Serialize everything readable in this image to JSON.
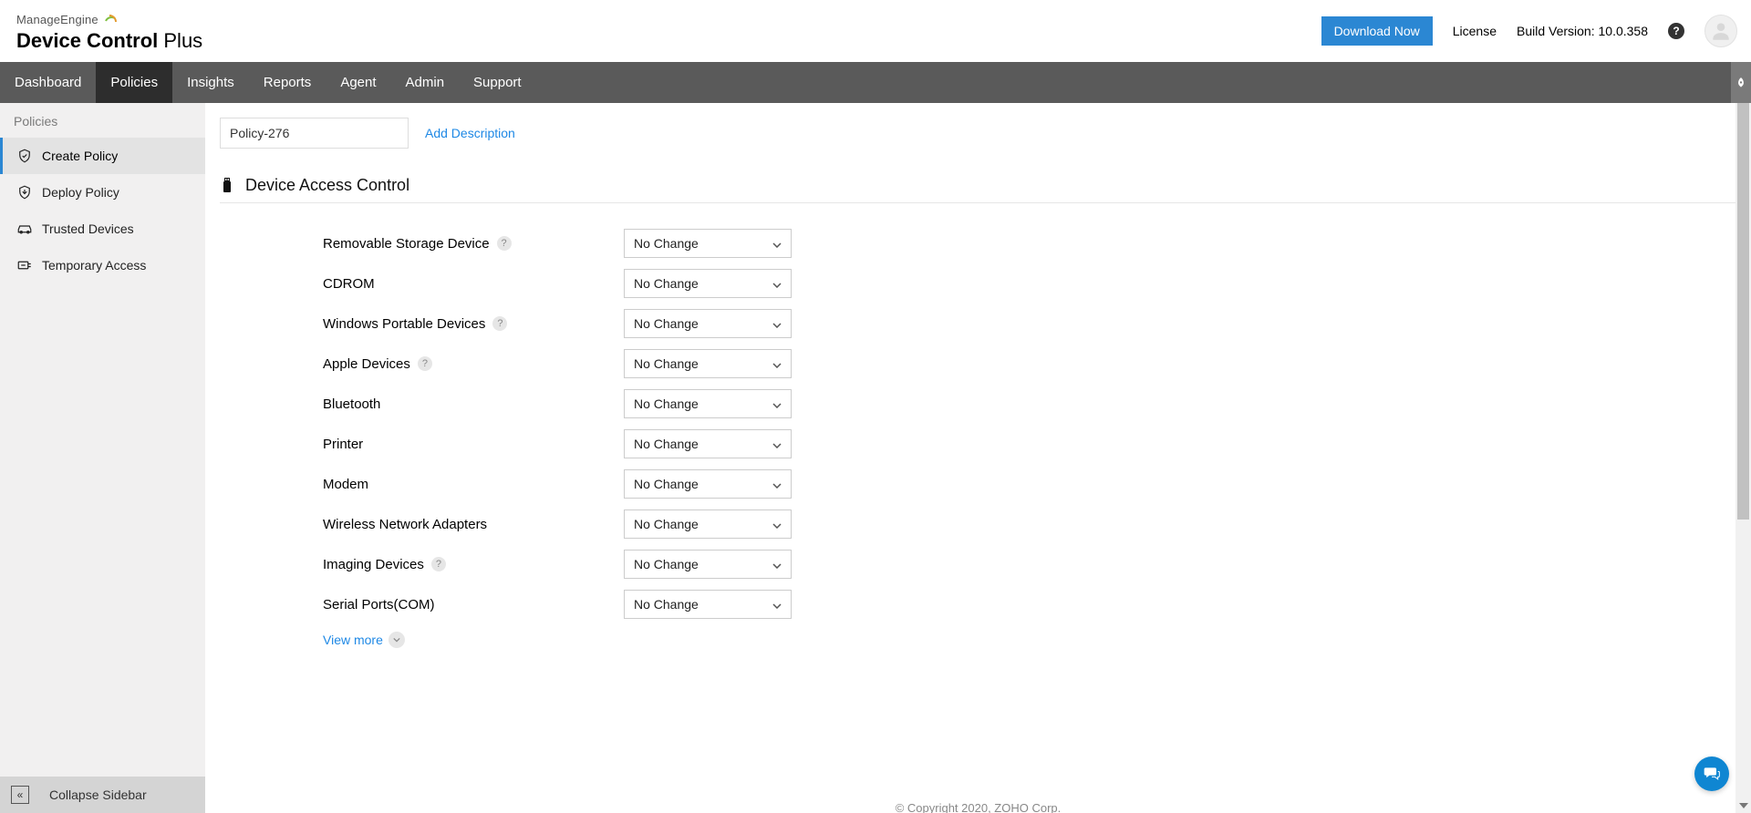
{
  "brand": {
    "top": "ManageEngine",
    "bottom_bold": "Device Control",
    "bottom_light": " Plus"
  },
  "header": {
    "download": "Download Now",
    "license": "License",
    "build": "Build Version: 10.0.358"
  },
  "nav": [
    "Dashboard",
    "Policies",
    "Insights",
    "Reports",
    "Agent",
    "Admin",
    "Support"
  ],
  "nav_active_index": 1,
  "sidebar": {
    "head": "Policies",
    "items": [
      {
        "label": "Create Policy",
        "icon": "shield-check",
        "active": true
      },
      {
        "label": "Deploy Policy",
        "icon": "shield-deploy",
        "active": false
      },
      {
        "label": "Trusted Devices",
        "icon": "car",
        "active": false
      },
      {
        "label": "Temporary Access",
        "icon": "access",
        "active": false
      }
    ],
    "collapse": "Collapse Sidebar"
  },
  "policy": {
    "name": "Policy-276",
    "add_description": "Add Description",
    "section_title": "Device Access Control",
    "rows": [
      {
        "label": "Removable Storage Device",
        "help": true,
        "value": "No Change"
      },
      {
        "label": "CDROM",
        "help": false,
        "value": "No Change"
      },
      {
        "label": "Windows Portable Devices",
        "help": true,
        "value": "No Change"
      },
      {
        "label": "Apple Devices",
        "help": true,
        "value": "No Change"
      },
      {
        "label": "Bluetooth",
        "help": false,
        "value": "No Change"
      },
      {
        "label": "Printer",
        "help": false,
        "value": "No Change"
      },
      {
        "label": "Modem",
        "help": false,
        "value": "No Change"
      },
      {
        "label": "Wireless Network Adapters",
        "help": false,
        "value": "No Change"
      },
      {
        "label": "Imaging Devices",
        "help": true,
        "value": "No Change"
      },
      {
        "label": "Serial Ports(COM)",
        "help": false,
        "value": "No Change"
      }
    ],
    "view_more": "View more"
  },
  "footer": "© Copyright 2020, ZOHO Corp."
}
